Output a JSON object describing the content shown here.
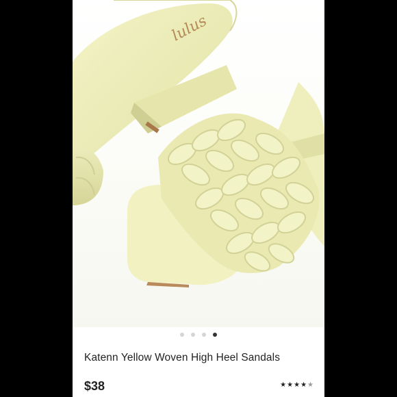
{
  "product": {
    "brand_logo_text": "lulus",
    "name": "Katenn Yellow Woven High Heel Sandals",
    "price": "$38",
    "rating": 4.5,
    "rating_max": 5
  },
  "carousel": {
    "total": 4,
    "active_index": 3
  },
  "colors": {
    "sandal_main": "#efefb8",
    "sandal_shadow": "#d9d99a",
    "heel_edge": "#b98a5a",
    "dot_active": "#333333",
    "dot_inactive": "#d4d4d4"
  }
}
